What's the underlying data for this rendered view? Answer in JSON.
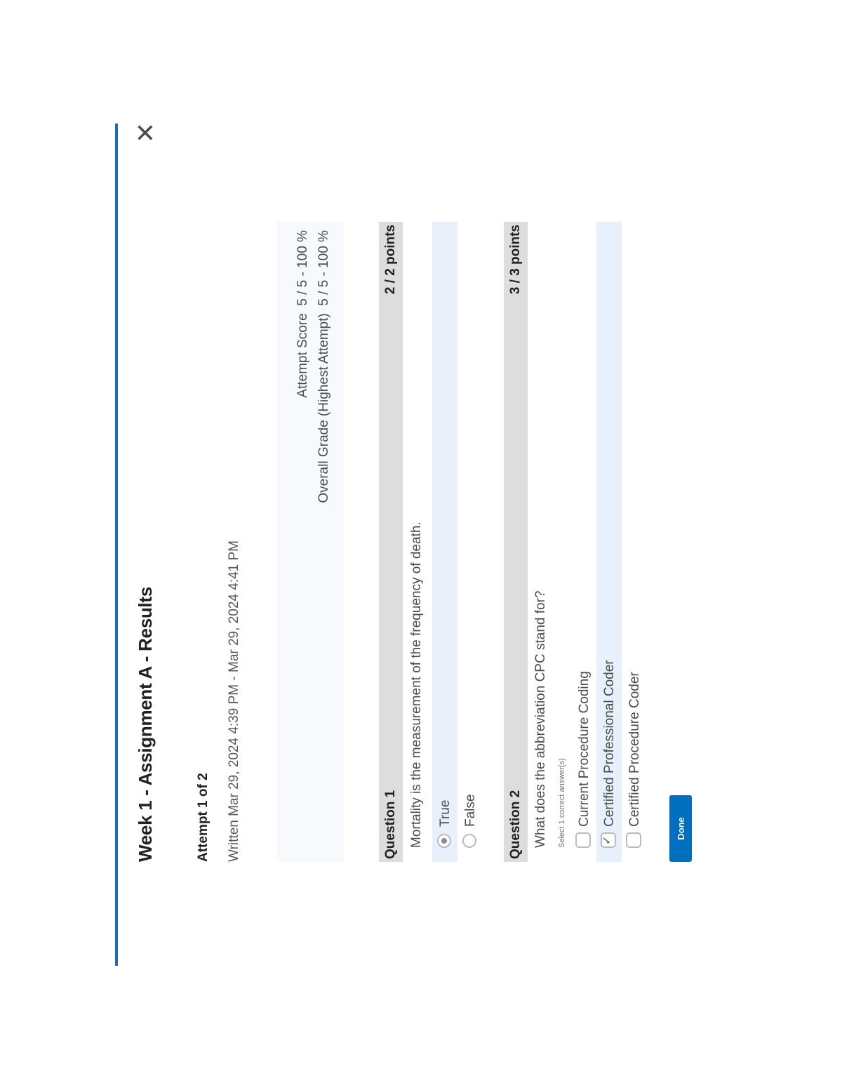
{
  "dialog": {
    "title": "Week 1 - Assignment A - Results",
    "close_icon": "close-icon",
    "attempt_label": "Attempt 1 of 2",
    "written": "Written Mar 29, 2024 4:39 PM - Mar 29, 2024 4:41 PM",
    "scores": {
      "attempt_score_label": "Attempt Score",
      "attempt_score_value": "5 / 5 - 100 %",
      "overall_grade_label": "Overall Grade (Highest Attempt)",
      "overall_grade_value": "5 / 5 - 100 %"
    },
    "questions": [
      {
        "label": "Question 1",
        "points": "2 / 2 points",
        "text": "Mortality is the measurement of the frequency of death.",
        "choices": [
          {
            "label": "True",
            "selected": true
          },
          {
            "label": "False",
            "selected": false
          }
        ]
      },
      {
        "label": "Question 2",
        "points": "3 / 3 points",
        "text": "What does the abbreviation CPC stand for?",
        "hint": "Select 1 correct answer(s)",
        "choices": [
          {
            "label": "Current Procedure Coding",
            "selected": false
          },
          {
            "label": "Certified Professional Coder",
            "selected": true
          },
          {
            "label": "Certified Procedure Coder",
            "selected": false
          }
        ]
      }
    ],
    "done_label": "Done"
  },
  "colors": {
    "accent": "#1f6db3",
    "primary_button": "#006fbf",
    "question_header": "#dddddd",
    "selected_row": "#e8f1fb"
  }
}
